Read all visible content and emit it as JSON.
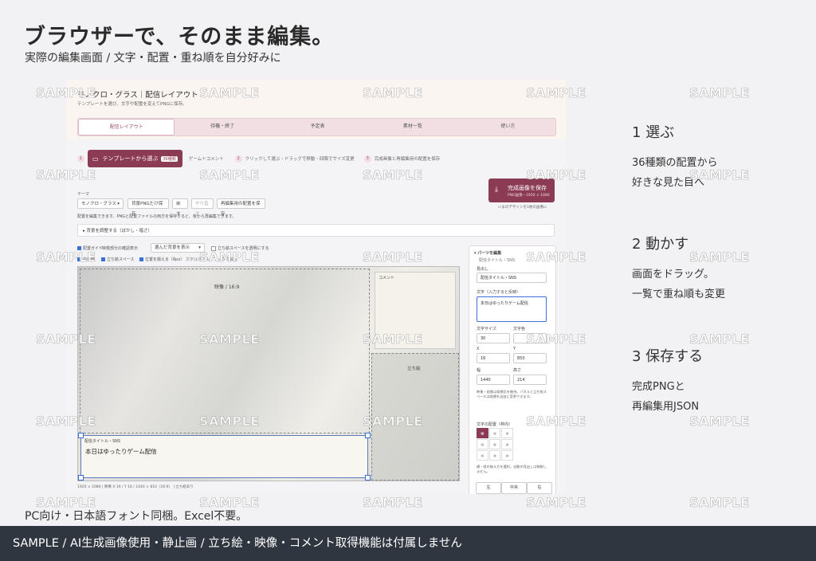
{
  "hero": {
    "title": "ブラウザーで、そのまま編集。",
    "subtitle": "実際の編集画面 / 文字・配置・重ね順を自分好みに"
  },
  "steps": [
    {
      "heading": "1  選ぶ",
      "line1": "36種類の配置から",
      "line2": "好きな見た目へ"
    },
    {
      "heading": "2  動かす",
      "line1": "画面をドラッグ。",
      "line2": "一覧で重ね順も変更"
    },
    {
      "heading": "3  保存する",
      "line1": "完成PNGと",
      "line2": "再編集用JSON"
    }
  ],
  "pc_note": "PC向け・日本語フォント同梱。Excel不要。",
  "footer": "SAMPLE / AI生成画像使用・静止画 / 立ち絵・映像・コメント取得機能は付属しません",
  "watermark": "SAMPLE",
  "app": {
    "title": "モノクロ・グラス｜配信レイアウト",
    "description": "テンプレートを選び、文字や配置を変えてPNGに保存。",
    "tabs": [
      "配信レイアウト",
      "待機・終了",
      "予定表",
      "素材一覧",
      "使い方"
    ],
    "step_bar": {
      "step1_num": "1",
      "template_button": "テンプレートから選ぶ",
      "template_count": "36種類",
      "game_comment": "ゲーム＋コメント",
      "step2_num": "2",
      "step2_text": "クリックして選ぶ・ドラッグで移動・四隅でサイズ変更",
      "step3_num": "3",
      "step3_text": "完成画像と再編集用の配置を保存"
    },
    "save_button": "完成画像を保存",
    "save_sub": "PNG画像・1920 × 1080",
    "save_note": "いまのデザインを1枚の画像に",
    "theme_label": "テーマ",
    "theme_value": "モノクロ・グラス",
    "btn_bg_png": "背景PNGだけ保存",
    "btn_undo": "戻す",
    "btn_redo": "やり直す",
    "btn_save_layout": "再編集用の配置を保存",
    "hint": "配置を編集できます。PNGと配置ファイルの両方を保存すると、後から再編集できます。",
    "bg_adjust": "▸ 背景を調整する（ぼかし・暗さ）",
    "options": {
      "guide": "配置ガイド",
      "video_check": "映像部分の確認表示",
      "bg_select": "選んだ背景を表示",
      "transparent": "立ち絵スペースを透明にする",
      "center": "中央線",
      "standee_space": "立ち絵スペース",
      "snap": "位置を揃える（8px）",
      "hint2": "文字はダブルクリックで編集"
    },
    "canvas": {
      "video": "映像 / 16:9",
      "comment": "コメント",
      "standee": "立ち絵",
      "title_label": "配信タイトル・SNS",
      "title_text": "本日はゆったりゲーム配信"
    },
    "meta": "1920 × 1080  |  映像 X 16 / Y 16 / 1440 × 810（16:9）  |  立ち絵あり",
    "panel": {
      "heading": "▾ パーツを編集",
      "subheading": "配信タイトル・SNS",
      "label_caption": "見出し",
      "caption_value": "配信タイトル・SNS",
      "label_text": "文字（入力すると反映）",
      "text_value": "本日はゆったりゲーム配信",
      "label_size": "文字サイズ",
      "label_color": "文字色",
      "size_value": "30",
      "label_x": "X",
      "label_y": "Y",
      "x_value": "16",
      "y_value": "850",
      "label_w": "幅",
      "label_h": "高さ",
      "w_value": "1440",
      "h_value": "214",
      "note": "映像・画像は縦横比を維持。パネルと立ち絵スペースは縦横を自由に変更できます。",
      "label_align": "文字の配置（枠内）",
      "align_note": "横・縦の揃え方を選択。自動の見出しは移動しません。",
      "align_left": "左",
      "align_center": "中央",
      "align_right": "右"
    }
  }
}
